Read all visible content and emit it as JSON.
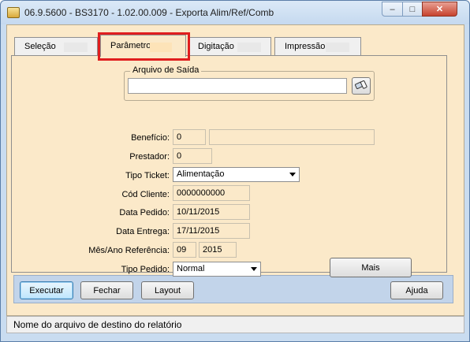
{
  "window": {
    "title": "06.9.5600 - BS3170 - 1.02.00.009 - Exporta Alim/Ref/Comb",
    "minimize_glyph": "–",
    "maximize_glyph": "□",
    "close_glyph": "✕"
  },
  "tabs": [
    {
      "label": "Seleção",
      "active": false
    },
    {
      "label": "Parâmetros",
      "active": true
    },
    {
      "label": "Digitação",
      "active": false
    },
    {
      "label": "Impressão",
      "active": false
    }
  ],
  "form": {
    "output_group_label": "Arquivo de Saída",
    "output_file_value": "",
    "beneficio_label": "Benefício:",
    "beneficio_value": "0",
    "beneficio_desc": "",
    "prestador_label": "Prestador:",
    "prestador_value": "0",
    "tipo_ticket_label": "Tipo Ticket:",
    "tipo_ticket_value": "Alimentação",
    "cod_cliente_label": "Cód Cliente:",
    "cod_cliente_value": "0000000000",
    "data_pedido_label": "Data Pedido:",
    "data_pedido_value": "10/11/2015",
    "data_entrega_label": "Data Entrega:",
    "data_entrega_value": "17/11/2015",
    "mes_ano_label": "Mês/Ano Referência:",
    "mes_value": "09",
    "ano_value": "2015",
    "tipo_pedido_label": "Tipo Pedido:",
    "tipo_pedido_value": "Normal",
    "mais_label": "Mais"
  },
  "buttons": {
    "executar": "Executar",
    "fechar": "Fechar",
    "layout": "Layout",
    "ajuda": "Ajuda"
  },
  "status": {
    "text": "Nome do arquivo de destino do relatório"
  },
  "colors": {
    "panel_bg": "#fbe9c9",
    "highlight": "#e01e1e",
    "window_frame": "#c9dcf0"
  }
}
